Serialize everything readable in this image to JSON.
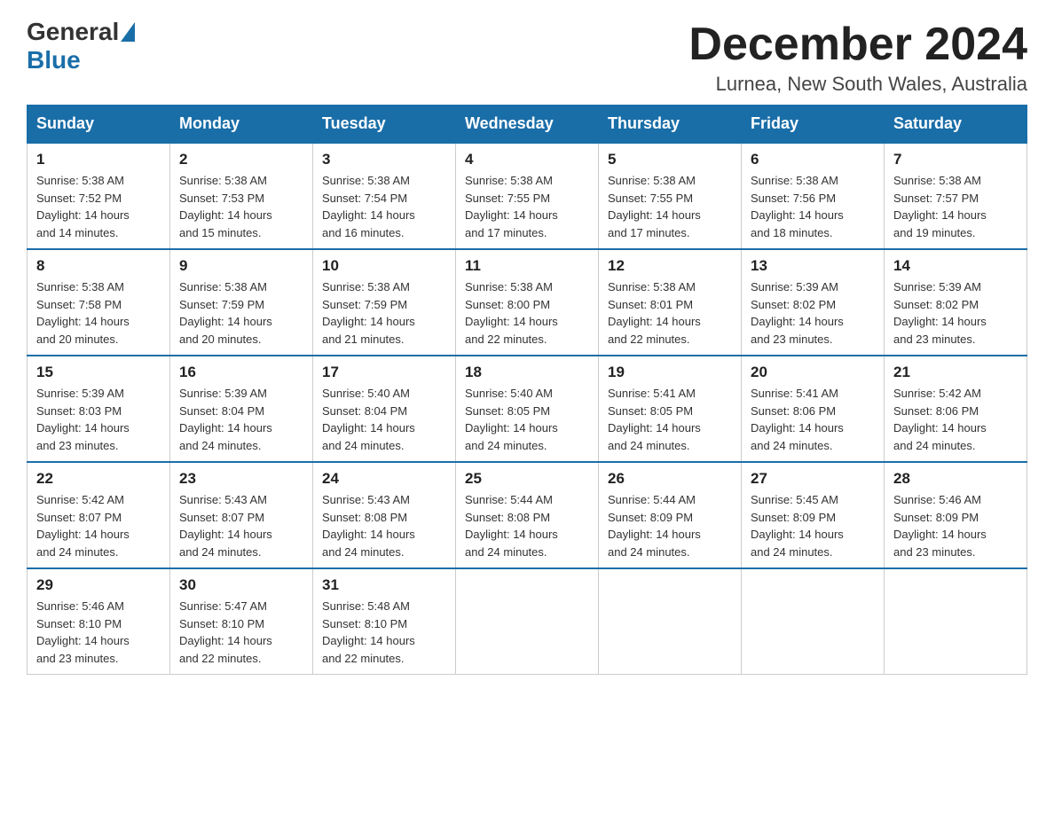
{
  "header": {
    "logo_general": "General",
    "logo_blue": "Blue",
    "month_title": "December 2024",
    "location": "Lurnea, New South Wales, Australia"
  },
  "weekdays": [
    "Sunday",
    "Monday",
    "Tuesday",
    "Wednesday",
    "Thursday",
    "Friday",
    "Saturday"
  ],
  "weeks": [
    [
      {
        "day": "1",
        "sunrise": "5:38 AM",
        "sunset": "7:52 PM",
        "daylight": "14 hours and 14 minutes."
      },
      {
        "day": "2",
        "sunrise": "5:38 AM",
        "sunset": "7:53 PM",
        "daylight": "14 hours and 15 minutes."
      },
      {
        "day": "3",
        "sunrise": "5:38 AM",
        "sunset": "7:54 PM",
        "daylight": "14 hours and 16 minutes."
      },
      {
        "day": "4",
        "sunrise": "5:38 AM",
        "sunset": "7:55 PM",
        "daylight": "14 hours and 17 minutes."
      },
      {
        "day": "5",
        "sunrise": "5:38 AM",
        "sunset": "7:55 PM",
        "daylight": "14 hours and 17 minutes."
      },
      {
        "day": "6",
        "sunrise": "5:38 AM",
        "sunset": "7:56 PM",
        "daylight": "14 hours and 18 minutes."
      },
      {
        "day": "7",
        "sunrise": "5:38 AM",
        "sunset": "7:57 PM",
        "daylight": "14 hours and 19 minutes."
      }
    ],
    [
      {
        "day": "8",
        "sunrise": "5:38 AM",
        "sunset": "7:58 PM",
        "daylight": "14 hours and 20 minutes."
      },
      {
        "day": "9",
        "sunrise": "5:38 AM",
        "sunset": "7:59 PM",
        "daylight": "14 hours and 20 minutes."
      },
      {
        "day": "10",
        "sunrise": "5:38 AM",
        "sunset": "7:59 PM",
        "daylight": "14 hours and 21 minutes."
      },
      {
        "day": "11",
        "sunrise": "5:38 AM",
        "sunset": "8:00 PM",
        "daylight": "14 hours and 22 minutes."
      },
      {
        "day": "12",
        "sunrise": "5:38 AM",
        "sunset": "8:01 PM",
        "daylight": "14 hours and 22 minutes."
      },
      {
        "day": "13",
        "sunrise": "5:39 AM",
        "sunset": "8:02 PM",
        "daylight": "14 hours and 23 minutes."
      },
      {
        "day": "14",
        "sunrise": "5:39 AM",
        "sunset": "8:02 PM",
        "daylight": "14 hours and 23 minutes."
      }
    ],
    [
      {
        "day": "15",
        "sunrise": "5:39 AM",
        "sunset": "8:03 PM",
        "daylight": "14 hours and 23 minutes."
      },
      {
        "day": "16",
        "sunrise": "5:39 AM",
        "sunset": "8:04 PM",
        "daylight": "14 hours and 24 minutes."
      },
      {
        "day": "17",
        "sunrise": "5:40 AM",
        "sunset": "8:04 PM",
        "daylight": "14 hours and 24 minutes."
      },
      {
        "day": "18",
        "sunrise": "5:40 AM",
        "sunset": "8:05 PM",
        "daylight": "14 hours and 24 minutes."
      },
      {
        "day": "19",
        "sunrise": "5:41 AM",
        "sunset": "8:05 PM",
        "daylight": "14 hours and 24 minutes."
      },
      {
        "day": "20",
        "sunrise": "5:41 AM",
        "sunset": "8:06 PM",
        "daylight": "14 hours and 24 minutes."
      },
      {
        "day": "21",
        "sunrise": "5:42 AM",
        "sunset": "8:06 PM",
        "daylight": "14 hours and 24 minutes."
      }
    ],
    [
      {
        "day": "22",
        "sunrise": "5:42 AM",
        "sunset": "8:07 PM",
        "daylight": "14 hours and 24 minutes."
      },
      {
        "day": "23",
        "sunrise": "5:43 AM",
        "sunset": "8:07 PM",
        "daylight": "14 hours and 24 minutes."
      },
      {
        "day": "24",
        "sunrise": "5:43 AM",
        "sunset": "8:08 PM",
        "daylight": "14 hours and 24 minutes."
      },
      {
        "day": "25",
        "sunrise": "5:44 AM",
        "sunset": "8:08 PM",
        "daylight": "14 hours and 24 minutes."
      },
      {
        "day": "26",
        "sunrise": "5:44 AM",
        "sunset": "8:09 PM",
        "daylight": "14 hours and 24 minutes."
      },
      {
        "day": "27",
        "sunrise": "5:45 AM",
        "sunset": "8:09 PM",
        "daylight": "14 hours and 24 minutes."
      },
      {
        "day": "28",
        "sunrise": "5:46 AM",
        "sunset": "8:09 PM",
        "daylight": "14 hours and 23 minutes."
      }
    ],
    [
      {
        "day": "29",
        "sunrise": "5:46 AM",
        "sunset": "8:10 PM",
        "daylight": "14 hours and 23 minutes."
      },
      {
        "day": "30",
        "sunrise": "5:47 AM",
        "sunset": "8:10 PM",
        "daylight": "14 hours and 22 minutes."
      },
      {
        "day": "31",
        "sunrise": "5:48 AM",
        "sunset": "8:10 PM",
        "daylight": "14 hours and 22 minutes."
      },
      null,
      null,
      null,
      null
    ]
  ],
  "labels": {
    "sunrise": "Sunrise:",
    "sunset": "Sunset:",
    "daylight": "Daylight:"
  }
}
